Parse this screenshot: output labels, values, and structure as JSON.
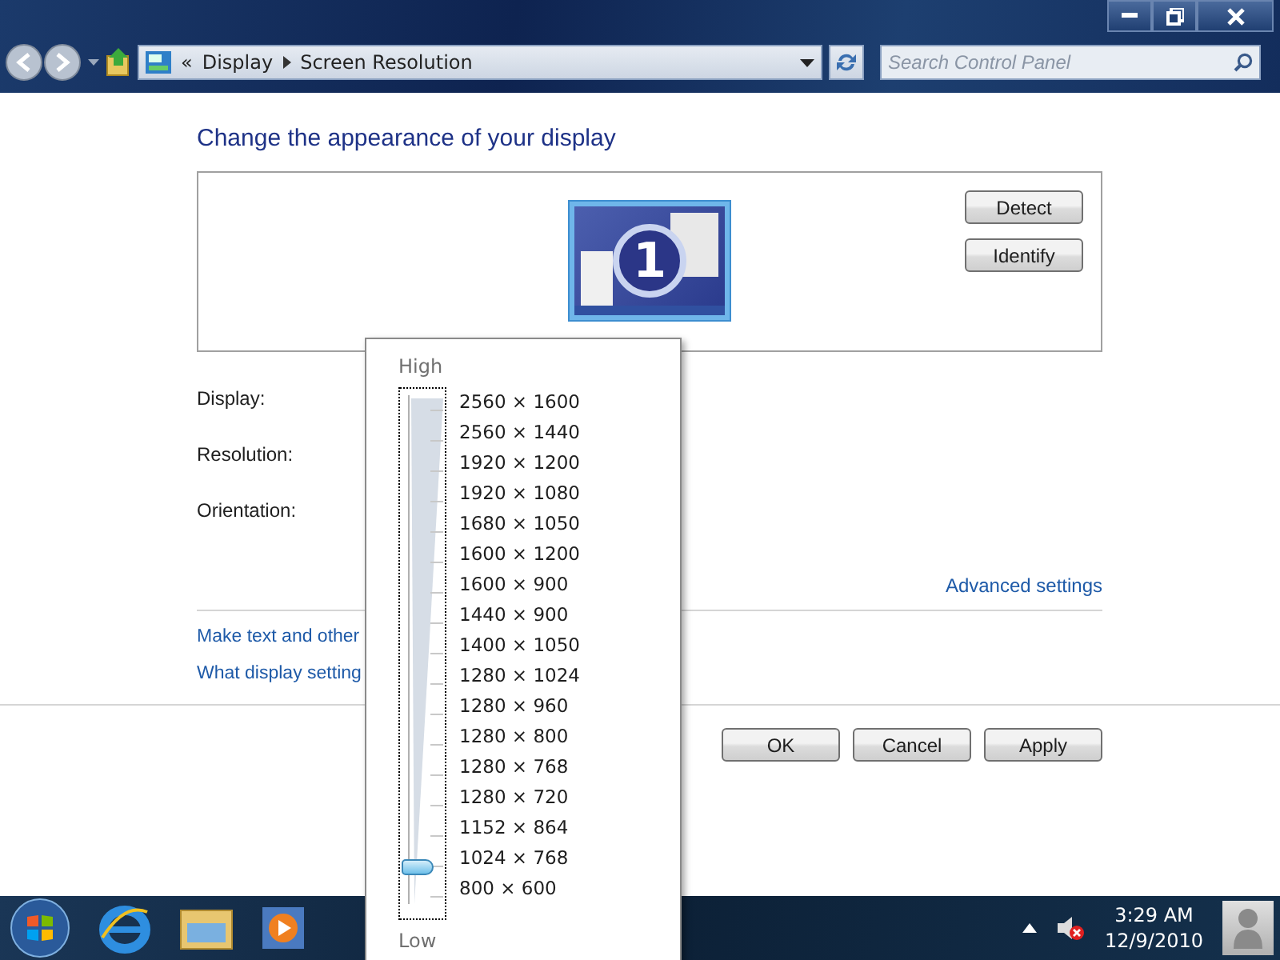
{
  "address_bar": {
    "chevron": "«",
    "breadcrumb": [
      "Display",
      "Screen Resolution"
    ],
    "search": {
      "placeholder": "Search Control Panel"
    }
  },
  "content": {
    "title": "Change the appearance of your display",
    "monitor": {
      "number": "1",
      "selected": true
    },
    "side_buttons": [
      "Detect",
      "Identify"
    ],
    "fields": [
      "Display:",
      "Resolution:",
      "Orientation:"
    ],
    "advanced_link": "Advanced settings",
    "links": [
      "Make text and other",
      "What display setting"
    ],
    "buttons": [
      "OK",
      "Cancel",
      "Apply"
    ]
  },
  "resolution_popup": {
    "high_label": "High",
    "low_label": "Low",
    "level": 0.0625,
    "options": [
      "2560 × 1600",
      "2560 × 1440",
      "1920 × 1200",
      "1920 × 1080",
      "1680 × 1050",
      "1600 × 1200",
      "1600 × 900",
      "1440 × 900",
      "1400 × 1050",
      "1280 × 1024",
      "1280 × 960",
      "1280 × 800",
      "1280 × 768",
      "1280 × 720",
      "1152 × 864",
      "1024 × 768",
      "800 × 600"
    ]
  },
  "taskbar": {
    "time": "3:29 AM",
    "date": "12/9/2010"
  }
}
